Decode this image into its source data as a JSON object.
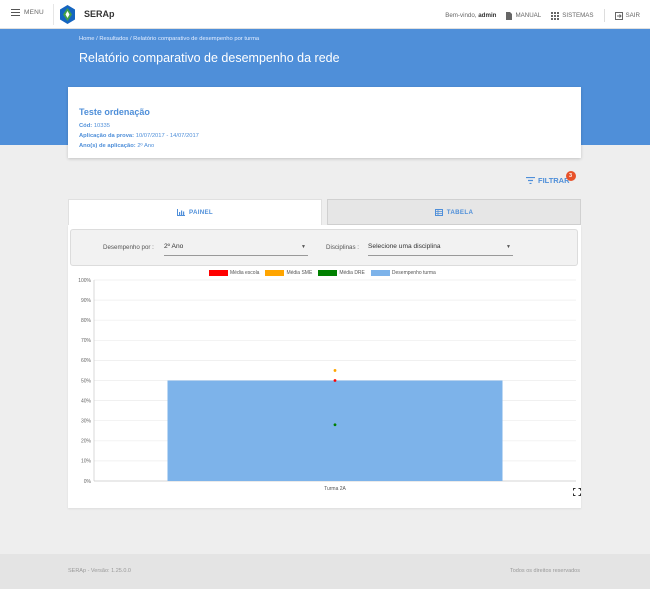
{
  "topbar": {
    "menu_label": "MENU",
    "app_name": "SERAp",
    "welcome_prefix": "Bem-vindo, ",
    "user": "admin",
    "manual_label": "MANUAL",
    "sistemas_label": "SISTEMAS",
    "sair_label": "SAIR",
    "logo_colors": [
      "#1565c0",
      "#43a047"
    ]
  },
  "breadcrumb": {
    "home": "Home",
    "resultados": "Resultados",
    "current": "Relatório comparativo de desempenho por turma",
    "separator": " / "
  },
  "page_title": "Relatório comparativo de desempenho da rede",
  "info": {
    "name": "Teste ordenação",
    "cod_label": "Cód:",
    "cod_value": "10335",
    "aplicacao_label": "Aplicação da prova:",
    "aplicacao_value": "10/07/2017 - 14/07/2017",
    "anos_label": "Ano(s) de aplicação:",
    "anos_value": "2º Ano"
  },
  "filter": {
    "label": "FILTRAR",
    "badge": "3"
  },
  "tabs": {
    "painel": "PAINEL",
    "tabela": "TABELA"
  },
  "filters": {
    "desempenho_label": "Desempenho por :",
    "desempenho_value": "2º Ano",
    "disciplinas_label": "Disciplinas :",
    "disciplinas_value": "Selecione uma disciplina"
  },
  "colors": {
    "accent": "#4f8fd9",
    "media_escola": "#ff0000",
    "media_sme": "#ffa500",
    "media_dre": "#008000",
    "desempenho_turma": "#7db3ea"
  },
  "chart_data": {
    "type": "bar",
    "categories": [
      "Turma 2A"
    ],
    "series": [
      {
        "name": "Desempenho turma",
        "values": [
          50
        ],
        "color": "#7db3ea"
      }
    ],
    "markers": [
      {
        "name": "Média escola",
        "values": [
          50
        ],
        "color": "#ff0000"
      },
      {
        "name": "Média SME",
        "values": [
          55
        ],
        "color": "#ffa500"
      },
      {
        "name": "Média DRE",
        "values": [
          28
        ],
        "color": "#008000"
      }
    ],
    "legend": [
      "Média escola",
      "Média SME",
      "Média DRE",
      "Desempenho turma"
    ],
    "yticks": [
      "0%",
      "10%",
      "20%",
      "30%",
      "40%",
      "50%",
      "60%",
      "70%",
      "80%",
      "90%",
      "100%"
    ],
    "ylim": [
      0,
      100
    ],
    "grid": true,
    "legend_position": "top"
  },
  "footer": {
    "version": "SERAp - Versão: 1.25.0.0",
    "rights": "Todos os direitos reservados"
  }
}
